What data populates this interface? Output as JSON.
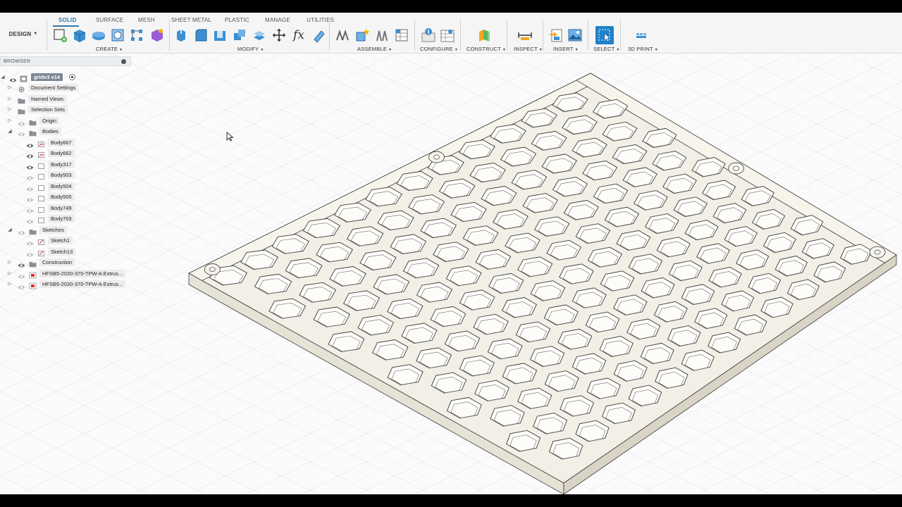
{
  "tabs": [
    "SOLID",
    "SURFACE",
    "MESH",
    "SHEET METAL",
    "PLASTIC",
    "MANAGE",
    "UTILITIES"
  ],
  "workspace": "DESIGN",
  "groups": {
    "create": "CREATE",
    "modify": "MODIFY",
    "assemble": "ASSEMBLE",
    "configure": "CONFIGURE",
    "construct": "CONSTRUCT",
    "inspect": "INSPECT",
    "insert": "INSERT",
    "select": "SELECT",
    "print3d": "3D PRINT"
  },
  "browser": {
    "title": "BROWSER",
    "items": [
      {
        "label": "gridv3 v14",
        "icon": "document-icon"
      },
      {
        "label": "Document Settings",
        "icon": "gear-icon"
      },
      {
        "label": "Named Views",
        "icon": "folder-icon"
      },
      {
        "label": "Selection Sets",
        "icon": "folder-icon"
      },
      {
        "label": "Origin",
        "icon": "folder-icon"
      },
      {
        "label": "Bodies",
        "icon": "folder-icon"
      },
      {
        "label": "Body667",
        "icon": "body-icon"
      },
      {
        "label": "Body662",
        "icon": "body-icon"
      },
      {
        "label": "Body317",
        "icon": "body-icon"
      },
      {
        "label": "Body503",
        "icon": "body-icon"
      },
      {
        "label": "Body504",
        "icon": "body-icon"
      },
      {
        "label": "Body505",
        "icon": "body-icon"
      },
      {
        "label": "Body749",
        "icon": "body-icon"
      },
      {
        "label": "Body703",
        "icon": "body-icon"
      },
      {
        "label": "Sketches",
        "icon": "folder-icon"
      },
      {
        "label": "Sketch1",
        "icon": "sketch-icon"
      },
      {
        "label": "Sketch13",
        "icon": "sketch-icon"
      },
      {
        "label": "Construction",
        "icon": "folder-icon"
      },
      {
        "label": "HFSB5-2020-370-TPW-A Extrus...",
        "icon": "component-icon"
      },
      {
        "label": "HFSB5-2020-370-TPW-A Extrus...",
        "icon": "component-icon"
      }
    ]
  },
  "colors": {
    "accent": "#2a7ab5",
    "model_fill": "#f2efe6",
    "model_edge": "#3a3a3a",
    "grid": "#dde3ea"
  }
}
